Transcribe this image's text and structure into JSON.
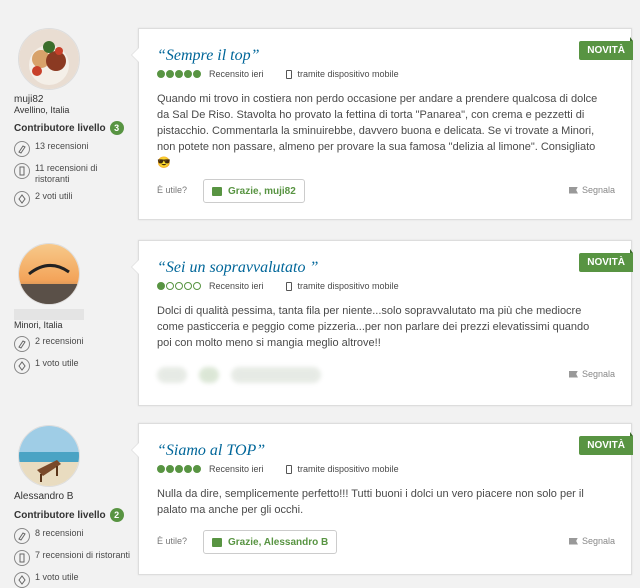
{
  "accent": "#589442",
  "title_color": "#006699",
  "reviews": [
    {
      "username": "muji82",
      "location": "Avellino, Italia",
      "level_label": "Contributore livello",
      "level": "3",
      "stats": [
        "13 recensioni",
        "11 recensioni di ristoranti",
        "2 voti utili"
      ],
      "stat_icons": [
        "pen-icon",
        "restaurant-icon",
        "thumb-icon"
      ],
      "title": "“Sempre il top”",
      "rating": 5,
      "date": "Recensito ieri",
      "device": "tramite dispositivo mobile",
      "badge": "NOVITÀ",
      "text": "Quando mi trovo in costiera non perdo occasione per andare a prendere qualcosa di dolce da Sal De Riso. Stavolta ho provato la fettina di torta \"Panarea\", con crema e pezzetti di pistacchio. Commentarla la sminuirebbe, davvero buona e delicata. Se vi trovate a Minori, non potete non passare, almeno per provare la sua famosa \"delizia al limone\". Consigliato 😎",
      "helpful": "È utile?",
      "thanks": "Grazie, muji82",
      "report": "Segnala"
    },
    {
      "username": "",
      "location": "Minori, Italia",
      "stats": [
        "2 recensioni",
        "1 voto utile"
      ],
      "stat_icons": [
        "pen-icon",
        "thumb-icon"
      ],
      "title": "“Sei un sopravvalutato ”",
      "rating": 1,
      "date": "Recensito ieri",
      "device": "tramite dispositivo mobile",
      "badge": "NOVITÀ",
      "text": "Dolci di qualità pessima, tanta fila per niente...solo sopravvalutato ma più che mediocre come pasticceria e peggio come pizzeria...per non parlare dei prezzi elevatissimi quando poi con molto meno si mangia meglio altrove!!",
      "report": "Segnala"
    },
    {
      "username": "Alessandro B",
      "level_label": "Contributore livello",
      "level": "2",
      "stats": [
        "8 recensioni",
        "7 recensioni di ristoranti",
        "1 voto utile"
      ],
      "stat_icons": [
        "pen-icon",
        "restaurant-icon",
        "thumb-icon"
      ],
      "title": "“Siamo al TOP”",
      "rating": 5,
      "date": "Recensito ieri",
      "device": "tramite dispositivo mobile",
      "badge": "NOVITÀ",
      "text": "Nulla da dire, semplicemente perfetto!!! Tutti buoni i dolci un vero piacere non solo per il palato ma anche per gli occhi.",
      "helpful": "È utile?",
      "thanks": "Grazie, Alessandro B",
      "report": "Segnala"
    }
  ]
}
